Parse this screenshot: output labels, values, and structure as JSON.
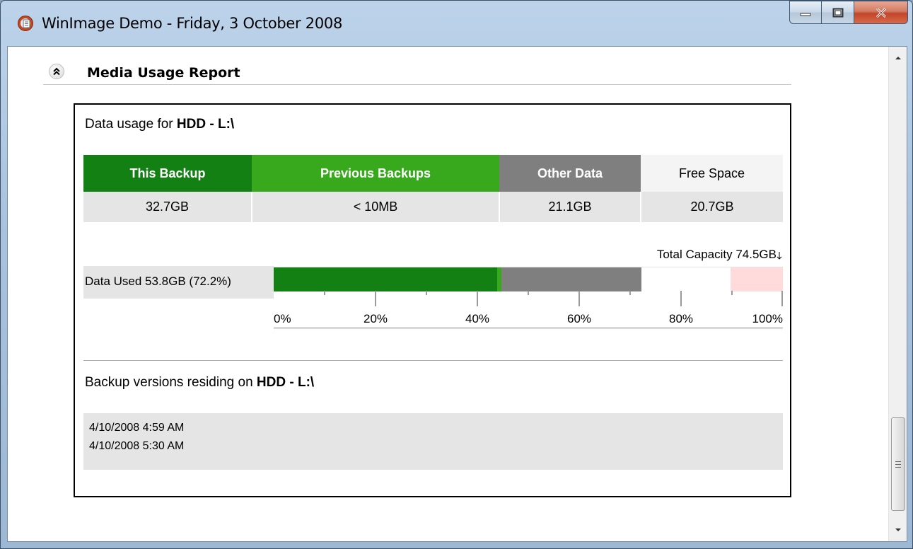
{
  "window": {
    "title": "WinImage Demo - Friday, 3 October 2008"
  },
  "section": {
    "title": "Media Usage Report"
  },
  "usage": {
    "heading_prefix": "Data usage for ",
    "heading_target": "HDD - L:\\",
    "columns": [
      {
        "label": "This Backup",
        "value": "32.7GB",
        "color": "#138013"
      },
      {
        "label": "Previous Backups",
        "value": "< 10MB",
        "color": "#38a81c"
      },
      {
        "label": "Other Data",
        "value": "21.1GB",
        "color": "#7f7f7f"
      },
      {
        "label": "Free Space",
        "value": "20.7GB",
        "color": "#f4f4f4"
      }
    ],
    "total_capacity": "Total Capacity 74.5GB",
    "data_used": "Data Used 53.8GB (72.2%)"
  },
  "usage_bar": {
    "segments": [
      {
        "name": "this-backup",
        "percent": 43.9,
        "color": "#138013"
      },
      {
        "name": "previous-backups",
        "percent": 0.8,
        "color": "#38a81c"
      },
      {
        "name": "other-data",
        "percent": 27.5,
        "color": "#7f7f7f"
      },
      {
        "name": "free-space",
        "percent": 17.5,
        "color": "#ffffff"
      },
      {
        "name": "reserved-zone",
        "percent": 10.3,
        "color": "#ffdbdc"
      }
    ],
    "axis_labels": [
      "0%",
      "20%",
      "40%",
      "60%",
      "80%",
      "100%"
    ]
  },
  "versions": {
    "heading_prefix": "Backup versions residing on ",
    "heading_target": "HDD - L:\\",
    "items": [
      "4/10/2008 4:59 AM",
      "4/10/2008 5:30 AM"
    ]
  }
}
